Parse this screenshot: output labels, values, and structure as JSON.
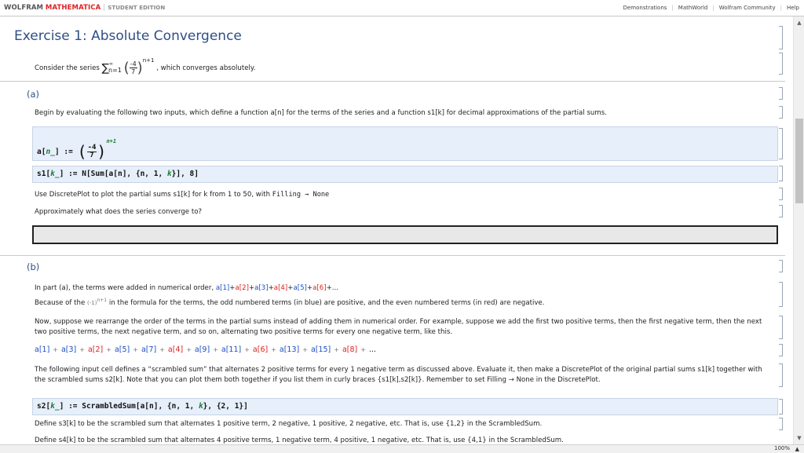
{
  "brand": {
    "part1": "WOLFRAM",
    "part2": "MATHEMATICA",
    "part3": "STUDENT EDITION"
  },
  "top_links": [
    "Demonstrations",
    "MathWorld",
    "Wolfram Community",
    "Help"
  ],
  "title": "Exercise 1: Absolute Convergence",
  "intro": {
    "prefix": "Consider the series",
    "sum_upper": "∞",
    "sum_lower": "n=1",
    "frac_num": "-4",
    "frac_den": "7",
    "exponent": "n+1",
    "suffix": ", which converges absolutely."
  },
  "part_a": {
    "label": "(a)",
    "instructions": "Begin by evaluating the following two inputs, which define a function a[n] for the terms of the series and a function s1[k] for decimal approximations of the partial sums.",
    "input1_lhs": "a[",
    "input1_var": "n_",
    "input1_mid": "] := ",
    "input1_num": "-4",
    "input1_den": "7",
    "input1_exp": "n+1",
    "input2_pre": "s1[",
    "input2_var": "k_",
    "input2_post": "] := N[Sum[a[n], {n, 1, ",
    "input2_var2": "k",
    "input2_end": "}], 8]",
    "plot_text_pre": "Use DiscretePlot to plot the partial sums s1[k] for k from 1 to 50, with ",
    "plot_text_code": "Filling → None",
    "question": "Approximately what does the series converge to?"
  },
  "part_b": {
    "label": "(b)",
    "line1": "In part (a), the terms were added in numerical order,",
    "terms1": [
      {
        "t": "a[1]",
        "c": "blue"
      },
      {
        "t": "a[2]",
        "c": "red"
      },
      {
        "t": "a[3]",
        "c": "blue"
      },
      {
        "t": "a[4]",
        "c": "red"
      },
      {
        "t": "a[5]",
        "c": "blue"
      },
      {
        "t": "a[6]",
        "c": "red"
      }
    ],
    "line2_pre": "Because of the",
    "line2_expr": "(-1)",
    "line2_exp": "n+1",
    "line2_post": "in the formula for the terms, the odd numbered terms (in blue) are positive, and the even numbered terms (in red) are negative.",
    "para": "Now, suppose we rearrange the order of the terms in the partial sums instead of adding them in numerical order. For example, suppose we add the first two positive terms, then the first negative term, then the next two positive terms, the next negative term, and so on, alternating two positive terms for every one negative term, like this.",
    "terms2": [
      {
        "t": "a[1]",
        "c": "blue"
      },
      {
        "t": "a[3]",
        "c": "blue"
      },
      {
        "t": "a[2]",
        "c": "red"
      },
      {
        "t": "a[5]",
        "c": "blue"
      },
      {
        "t": "a[7]",
        "c": "blue"
      },
      {
        "t": "a[4]",
        "c": "red"
      },
      {
        "t": "a[9]",
        "c": "blue"
      },
      {
        "t": "a[11]",
        "c": "blue"
      },
      {
        "t": "a[6]",
        "c": "red"
      },
      {
        "t": "a[13]",
        "c": "blue"
      },
      {
        "t": "a[15]",
        "c": "blue"
      },
      {
        "t": "a[8]",
        "c": "red"
      }
    ],
    "scrambled_text": "The following input cell defines a “scrambled sum” that alternates 2 positive terms for every 1 negative term as discussed above. Evaluate it, then make a DiscretePlot of the original partial sums s1[k] together with the scrambled sums s2[k]. Note that you can plot them both together if you list them in curly braces {s1[k],s2[k]}. Remember to set Filling → None in the DiscretePlot.",
    "input3_pre": "s2[",
    "input3_var": "k_",
    "input3_mid": "] := ScrambledSum[a[n], {n, 1, ",
    "input3_var2": "k",
    "input3_end": "}, {2, 1}]",
    "define_s3": "Define s3[k] to be the scrambled sum that alternates 1 positive term, 2 negative, 1 positive, 2 negative, etc. That is, use {1,2} in the ScrambledSum.",
    "define_s4": "Define s4[k] to be the scrambled sum that alternates 4 positive terms, 1 negative term, 4 positive, 1 negative, etc. That is, use {4,1} in the ScrambledSum."
  },
  "status": {
    "zoom": "100%"
  }
}
